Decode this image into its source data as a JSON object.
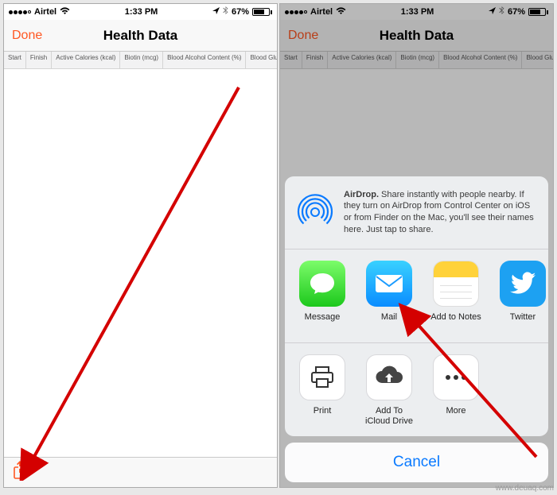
{
  "status": {
    "carrier": "Airtel",
    "time": "1:33 PM",
    "battery_pct": "67%"
  },
  "nav": {
    "done": "Done",
    "title": "Health Data"
  },
  "columns": [
    "Start",
    "Finish",
    "Active Calories (kcal)",
    "Biotin (mcg)",
    "Blood Alcohol Content (%)",
    "Blood Glucose"
  ],
  "sheet": {
    "airdrop_bold": "AirDrop.",
    "airdrop_text": " Share instantly with people nearby. If they turn on AirDrop from Control Center on iOS or from Finder on the Mac, you'll see their names here. Just tap to share.",
    "apps": [
      {
        "label": "Message",
        "icon": "message"
      },
      {
        "label": "Mail",
        "icon": "mail"
      },
      {
        "label": "Add to Notes",
        "icon": "notes"
      },
      {
        "label": "Twitter",
        "icon": "twitter"
      }
    ],
    "actions": [
      {
        "label": "Print",
        "icon": "print"
      },
      {
        "label": "Add To\niCloud Drive",
        "icon": "cloud"
      },
      {
        "label": "More",
        "icon": "more"
      }
    ],
    "cancel": "Cancel"
  },
  "watermark": "www.deuaq.com"
}
